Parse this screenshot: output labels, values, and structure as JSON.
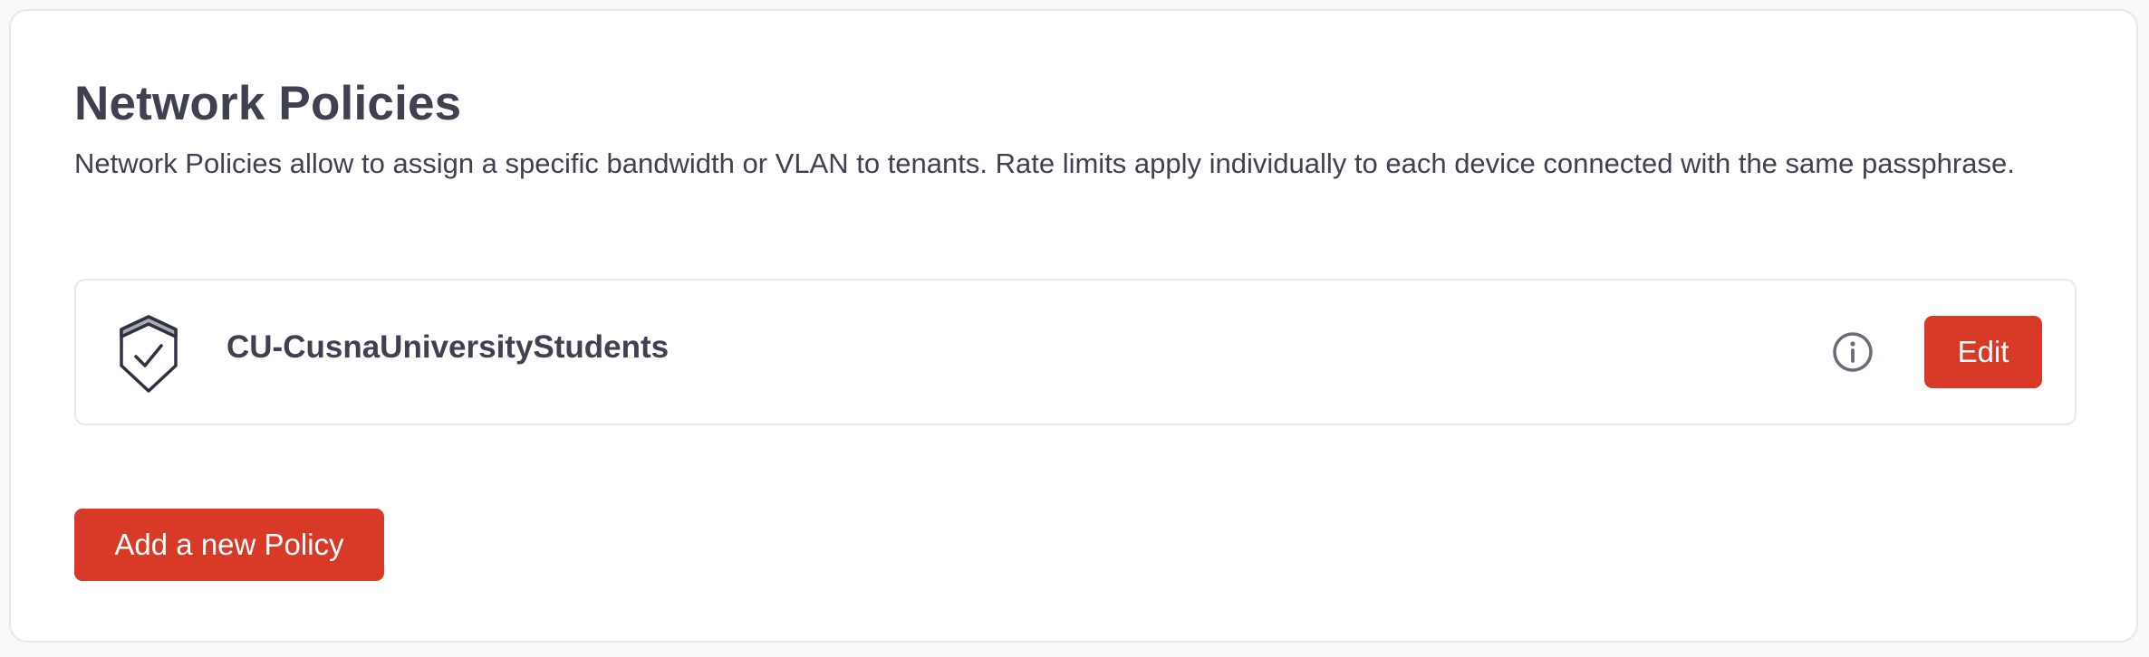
{
  "section": {
    "title": "Network Policies",
    "description": "Network Policies allow to assign a specific bandwidth or VLAN to tenants. Rate limits apply individually to each device connected with the same passphrase."
  },
  "policies": [
    {
      "name": "CU-CusnaUniversityStudents",
      "icon": "shield-check-icon",
      "edit_label": "Edit",
      "info_icon": "info-icon"
    }
  ],
  "actions": {
    "add_label": "Add a new Policy"
  },
  "colors": {
    "accent": "#d93a28",
    "text": "#3f4150",
    "border": "#e6e8ec",
    "background": "#f8f9fb"
  }
}
